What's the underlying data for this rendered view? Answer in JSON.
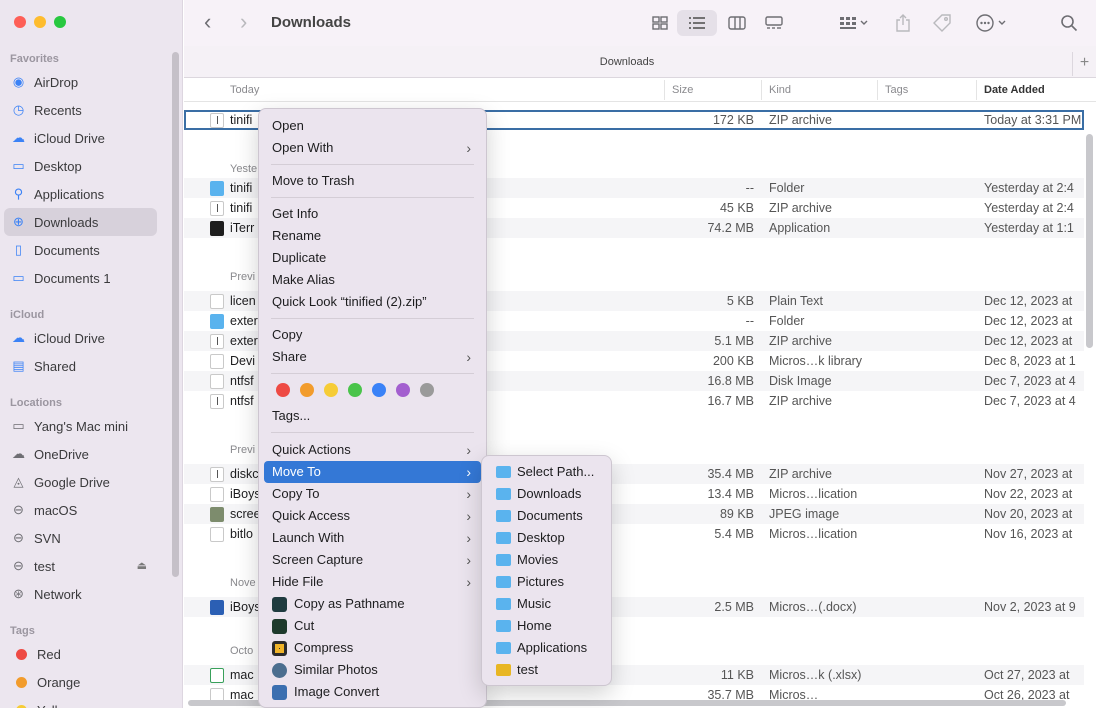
{
  "colors": {
    "traffic_close": "#fe5f57",
    "traffic_min": "#febc2e",
    "traffic_max": "#28c840",
    "accent": "#3478d6",
    "sidebar_icon": "#3b82f6"
  },
  "sidebar": {
    "favorites_header": "Favorites",
    "favorites": [
      {
        "label": "AirDrop",
        "icon": "airdrop-icon"
      },
      {
        "label": "Recents",
        "icon": "clock-icon"
      },
      {
        "label": "iCloud Drive",
        "icon": "cloud-icon"
      },
      {
        "label": "Desktop",
        "icon": "desktop-icon"
      },
      {
        "label": "Applications",
        "icon": "applications-icon"
      },
      {
        "label": "Downloads",
        "icon": "download-icon",
        "active": true
      },
      {
        "label": "Documents",
        "icon": "document-icon"
      },
      {
        "label": "Documents 1",
        "icon": "folder-icon"
      }
    ],
    "icloud_header": "iCloud",
    "icloud": [
      {
        "label": "iCloud Drive",
        "icon": "cloud-icon"
      },
      {
        "label": "Shared",
        "icon": "shared-folder-icon"
      }
    ],
    "locations_header": "Locations",
    "locations": [
      {
        "label": "Yang's Mac mini",
        "icon": "computer-icon"
      },
      {
        "label": "OneDrive",
        "icon": "cloud-icon"
      },
      {
        "label": "Google Drive",
        "icon": "drive-icon"
      },
      {
        "label": "macOS",
        "icon": "disk-icon"
      },
      {
        "label": "SVN",
        "icon": "disk-icon"
      },
      {
        "label": "test",
        "icon": "external-disk-icon"
      },
      {
        "label": "Network",
        "icon": "network-icon"
      }
    ],
    "tags_header": "Tags",
    "tags": [
      {
        "label": "Red",
        "color": "#ee4a44"
      },
      {
        "label": "Orange",
        "color": "#f29c2c"
      },
      {
        "label": "Yellow",
        "color": "#f6cc36"
      }
    ]
  },
  "toolbar": {
    "title": "Downloads",
    "back": "‹",
    "forward": "›",
    "path_title": "Downloads",
    "plus": "+"
  },
  "columns": {
    "name": "Today",
    "size": "Size",
    "kind": "Kind",
    "tags": "Tags",
    "date": "Date Added"
  },
  "groups": {
    "today": "Today",
    "yesterday": "Yeste",
    "prev7": "Previ",
    "prev30": "Previ",
    "november": "Nove",
    "october": "Octo"
  },
  "rows": [
    {
      "name": "tinifi",
      "size": "172 KB",
      "kind": "ZIP archive",
      "date": "Today at 3:31 PM",
      "icon": "zip"
    },
    {
      "name": "tinifi",
      "size": "--",
      "kind": "Folder",
      "date": "Yesterday at 2:4",
      "icon": "folder"
    },
    {
      "name": "tinifi",
      "size": "45 KB",
      "kind": "ZIP archive",
      "date": "Yesterday at 2:4",
      "icon": "zip"
    },
    {
      "name": "iTerr",
      "size": "74.2 MB",
      "kind": "Application",
      "date": "Yesterday at 1:1",
      "icon": "app"
    },
    {
      "name": "licen",
      "size": "5 KB",
      "kind": "Plain Text",
      "date": "Dec 12, 2023 at",
      "icon": "doc"
    },
    {
      "name": "exter",
      "size": "--",
      "kind": "Folder",
      "date": "Dec 12, 2023 at",
      "icon": "folder"
    },
    {
      "name": "exter",
      "size": "5.1 MB",
      "kind": "ZIP archive",
      "date": "Dec 12, 2023 at",
      "icon": "zip"
    },
    {
      "name": "Devi",
      "size": "200 KB",
      "kind": "Micros…k library",
      "date": "Dec 8, 2023 at 1",
      "icon": "doc"
    },
    {
      "name": "ntfsf",
      "size": "16.8 MB",
      "kind": "Disk Image",
      "date": "Dec 7, 2023 at 4",
      "icon": "doc"
    },
    {
      "name": "ntfsf",
      "size": "16.7 MB",
      "kind": "ZIP archive",
      "date": "Dec 7, 2023 at 4",
      "icon": "zip"
    },
    {
      "name": "diskc",
      "size": "35.4 MB",
      "kind": "ZIP archive",
      "date": "Nov 27, 2023 at",
      "icon": "zip"
    },
    {
      "name": "iBoys",
      "size": "13.4 MB",
      "kind": "Micros…lication",
      "date": "Nov 22, 2023 at",
      "icon": "doc"
    },
    {
      "name": "scree",
      "size": "89 KB",
      "kind": "JPEG image",
      "date": "Nov 20, 2023 at",
      "icon": "img"
    },
    {
      "name": "bitlo",
      "size": "5.4 MB",
      "kind": "Micros…lication",
      "date": "Nov 16, 2023 at",
      "icon": "doc"
    },
    {
      "name": "iBoys",
      "size": "2.5 MB",
      "kind": "Micros…(.docx)",
      "date": "Nov 2, 2023 at 9",
      "icon": "word"
    },
    {
      "name": "mac",
      "size": "11 KB",
      "kind": "Micros…k (.xlsx)",
      "date": "Oct 27, 2023 at",
      "icon": "xlsx"
    },
    {
      "name": "mac",
      "size": "35.7 MB",
      "kind": "Micros…",
      "date": "Oct 26, 2023 at",
      "icon": "doc"
    }
  ],
  "context_menu": {
    "open": "Open",
    "open_with": "Open With",
    "move_to_trash": "Move to Trash",
    "get_info": "Get Info",
    "rename": "Rename",
    "duplicate": "Duplicate",
    "make_alias": "Make Alias",
    "quick_look": "Quick Look “tinified (2).zip”",
    "copy": "Copy",
    "share": "Share",
    "tag_colors": [
      "#ee4a44",
      "#f29c2c",
      "#f6cc36",
      "#4ac44a",
      "#3a82f7",
      "#a35fcf",
      "#9a9a9a"
    ],
    "tags": "Tags...",
    "quick_actions": "Quick Actions",
    "move_to": "Move To",
    "copy_to": "Copy To",
    "quick_access": "Quick Access",
    "launch_with": "Launch With",
    "screen_capture": "Screen Capture",
    "hide_file": "Hide File",
    "copy_as_pathname": "Copy as Pathname",
    "cut": "Cut",
    "compress": "Compress",
    "similar_photos": "Similar Photos",
    "image_convert": "Image Convert"
  },
  "submenu": [
    "Select Path...",
    "Downloads",
    "Documents",
    "Desktop",
    "Movies",
    "Pictures",
    "Music",
    "Home",
    "Applications",
    "test"
  ]
}
